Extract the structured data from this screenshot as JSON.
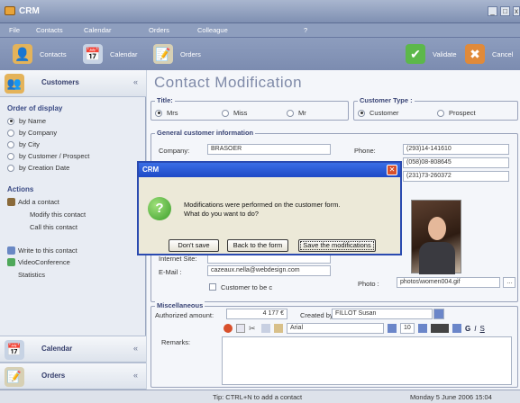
{
  "window": {
    "title": "CRM"
  },
  "menu": [
    "File",
    "Contacts",
    "Calendar",
    "Orders",
    "Colleague",
    "?"
  ],
  "toolbar": {
    "contacts": "Contacts",
    "calendar": "Calendar",
    "orders": "Orders",
    "validate": "Validate",
    "cancel": "Cancel"
  },
  "sidebar": {
    "header": "Customers",
    "order_title": "Order of display",
    "order_options": [
      "by Name",
      "by Company",
      "by City",
      "by Customer / Prospect",
      "by Creation Date"
    ],
    "actions_title": "Actions",
    "actions": [
      "Add a contact",
      "Modify this contact",
      "Call this contact",
      "Write to this contact",
      "VideoConference",
      "Statistics"
    ],
    "calendar": "Calendar",
    "orders": "Orders"
  },
  "form": {
    "page_title": "Contact Modification",
    "title_legend": "Title:",
    "title_options": [
      "Mrs",
      "Miss",
      "Mr"
    ],
    "custtype_legend": "Customer Type :",
    "custtype_options": [
      "Customer",
      "Prospect"
    ],
    "general_legend": "General customer information",
    "company_label": "Company:",
    "company_value": "BRASOER",
    "phone_label": "Phone:",
    "phone_value": "(293)14-141610",
    "phone2_value": "(058)08-808645",
    "phone3_value": "(231)73-260372",
    "internet_label": "Internet Site:",
    "email_label": "E-Mail :",
    "email_value": "cazeaux.nella@webdesign.com",
    "customer_to_be": "Customer to be c",
    "photo_label": "Photo :",
    "photo_value": "photos\\women004.gif",
    "misc_legend": "Miscellaneous",
    "authorized_label": "Authorized amount:",
    "authorized_value": "4 177 €",
    "created_by_label": "Created by:",
    "created_by_value": "FILLOT Susan",
    "font_value": "Arial",
    "font_size": "10",
    "remarks_label": "Remarks:"
  },
  "dialog": {
    "title": "CRM",
    "message_line1": "Modifications were performed on the customer form.",
    "message_line2": "What do you want to do?",
    "btn_dont_save": "Don't save",
    "btn_back": "Back to the form",
    "btn_save": "Save the modifications"
  },
  "status": {
    "tip": "Tip: CTRL+N to add a contact",
    "date": "Monday 5 June 2006 15:04"
  },
  "colors": {
    "accent": "#3a6ee6",
    "toolbar": "#8d9dbe"
  }
}
